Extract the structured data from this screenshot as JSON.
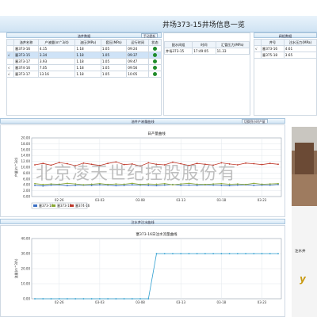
{
  "window": {
    "title": "井场373-15井场信息一览"
  },
  "left_panel": {
    "header": "油井数据",
    "button": "手动更新",
    "columns": [
      "油井名称",
      "产液量(m^3/d)",
      "油压(MPa)",
      "套压(MPa)",
      "运行时间",
      "状态"
    ],
    "rows": [
      {
        "mark": "",
        "name": "塞373-16",
        "output": "4.15",
        "oil_pressure": "1.18",
        "casing_pressure": "1.05",
        "runtime": "09:24",
        "status_color": "#1f8b2a"
      },
      {
        "mark": "√",
        "name": "塞373-15",
        "output": "3.34",
        "oil_pressure": "1.18",
        "casing_pressure": "1.05",
        "runtime": "09:37",
        "status_color": "#1f8b2a"
      },
      {
        "mark": "",
        "name": "塞373-17",
        "output": "3.93",
        "oil_pressure": "1.18",
        "casing_pressure": "1.05",
        "runtime": "09:47",
        "status_color": "#1f8b2a"
      },
      {
        "mark": "√",
        "name": "塞374-16",
        "output": "7.05",
        "oil_pressure": "1.18",
        "casing_pressure": "1.05",
        "runtime": "09:56",
        "status_color": "#1f8b2a"
      },
      {
        "mark": "√",
        "name": "塞373-17",
        "output": "13.16",
        "oil_pressure": "1.18",
        "casing_pressure": "1.05",
        "runtime": "10:05",
        "status_color": "#1f8b2a"
      }
    ]
  },
  "middle_panel": {
    "columns": [
      "配水间组",
      "时间",
      "汇管压力(MPa)"
    ],
    "rows": [
      {
        "group": "井场373-15",
        "time": "17:49:05",
        "pressure": "11.33"
      }
    ]
  },
  "right_panel": {
    "header": "阀组数据",
    "columns": [
      "井号",
      "注水压力(MPa)"
    ],
    "rows": [
      {
        "mark": "√",
        "well": "塞373-16",
        "pressure": "4.61"
      },
      {
        "mark": "",
        "well": "塞375-18",
        "pressure": "3.65"
      }
    ]
  },
  "chart1_panel": {
    "header": "油井产液量曲线",
    "button": "切换到小时产量"
  },
  "chart2_panel": {
    "header": "注水井注水曲线"
  },
  "photo_caption": "注水井",
  "watermark": "北京凌天世纪控股股份有",
  "chart_data": [
    {
      "type": "line",
      "title": "日产量曲线",
      "ylabel": "产量(m^3/d)",
      "xlabel": "",
      "x": [
        "02-26",
        "03-03",
        "03-08",
        "03-13",
        "03-18",
        "03-23"
      ],
      "yticks": [
        "0.00",
        "2.00",
        "4.00",
        "6.00",
        "8.00",
        "10.00",
        "12.00",
        "14.00",
        "16.00",
        "18.00",
        "20.00"
      ],
      "ylim": [
        0,
        20
      ],
      "grid": true,
      "legend_position": "bottom-left",
      "series": [
        {
          "name": "塞373-16",
          "color": "#3a6fc4",
          "values": [
            3.8,
            3.6,
            3.9,
            4.0,
            3.7,
            3.8,
            3.9,
            3.8,
            4.0,
            3.9,
            3.7,
            3.8,
            4.0,
            3.9,
            3.8,
            3.7,
            3.9,
            4.1,
            3.8,
            3.9,
            3.8,
            4.0,
            3.9,
            3.8,
            3.7,
            3.9,
            4.0,
            3.8,
            3.9,
            3.9,
            4.1
          ]
        },
        {
          "name": "塞373-17",
          "color": "#8aa832",
          "values": [
            4.4,
            4.1,
            4.3,
            4.2,
            4.5,
            4.3,
            4.0,
            4.2,
            4.4,
            4.1,
            4.3,
            4.2,
            4.5,
            4.1,
            4.3,
            4.2,
            4.4,
            4.0,
            4.3,
            4.5,
            4.2,
            4.1,
            4.3,
            4.4,
            4.2,
            4.3,
            4.1,
            4.5,
            4.2,
            4.3,
            4.4
          ]
        },
        {
          "name": "塞374-16",
          "color": "#c0392b",
          "values": [
            10.8,
            11.3,
            10.7,
            11.6,
            11.2,
            10.5,
            11.4,
            11.0,
            10.6,
            11.3,
            11.8,
            10.9,
            11.1,
            10.4,
            11.5,
            11.0,
            10.8,
            11.7,
            11.2,
            10.6,
            11.3,
            11.0,
            10.7,
            11.5,
            11.1,
            10.8,
            11.4,
            11.2,
            10.9,
            11.3,
            11.0
          ]
        }
      ]
    },
    {
      "type": "line",
      "title": "塞373-16日注水流量曲线",
      "ylabel": "流量(m^3/h)",
      "xlabel": "",
      "x": [
        "02-26",
        "03-03",
        "03-08",
        "03-13",
        "03-18",
        "03-23"
      ],
      "yticks": [
        "0.00",
        "10.00",
        "20.00",
        "30.00",
        "40.00"
      ],
      "ylim": [
        0,
        40
      ],
      "grid": true,
      "series": [
        {
          "name": "",
          "color": "#2f9fd0",
          "values": [
            0,
            0,
            0,
            0,
            0,
            0,
            0,
            0,
            0,
            0,
            0,
            0,
            0,
            0,
            0,
            30,
            30,
            30,
            30,
            30,
            30,
            30,
            30,
            30,
            30,
            30,
            30,
            30,
            30,
            30,
            30
          ]
        }
      ]
    }
  ]
}
